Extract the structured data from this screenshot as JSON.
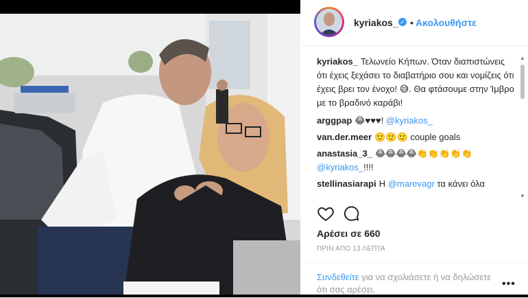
{
  "post": {
    "username": "kyriakos_",
    "separator": "•",
    "follow_label": "Ακολουθήστε",
    "caption_user": "kyriakos_",
    "caption_text": "Τελωνείο Κήπων. Όταν διαπιστώνεις ότι έχεις ξεχάσει το διαβατήριο σου και νομίζεις ότι έχεις βρει τον ένοχο! 😅. Θα φτάσουμε στην Ίμβρο με το βραδινό καράβι!",
    "comments": [
      {
        "user": "arggpap",
        "text": "😂♥♥♥! ",
        "mention": "@kyriakos_"
      },
      {
        "user": "van.der.meer",
        "text": "🙂🙂🙂 couple goals"
      },
      {
        "user": "anastasia_3_",
        "text": "😂😂😂😂👏👏👏👏👏 ",
        "mention": "@kyriakos_",
        "text_after": "!!!!"
      },
      {
        "user": "stellinasiarapi",
        "text": "Η ",
        "mention": "@marevagr",
        "text_after": " τα κάνει όλα"
      }
    ],
    "likes_text": "Αρέσει σε 660",
    "time_text": "ΠΡΙΝ ΑΠΟ 13 ΛΕΠΤΑ",
    "login_link": "Συνδεθείτε",
    "login_text": " για να σχολιάσετε ή να δηλώσετε ότι σας αρέσει.",
    "more_label": "•••"
  },
  "icons": {
    "like": "heart-icon",
    "comment": "comment-icon",
    "verified": "verified-badge-icon"
  },
  "colors": {
    "link": "#3897f0",
    "text": "#262626",
    "muted": "#999999"
  }
}
